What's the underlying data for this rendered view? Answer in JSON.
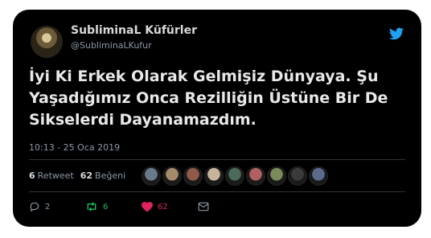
{
  "author": {
    "display_name": "SubliminaL Küfürler",
    "handle": "@SubliminaLKufur"
  },
  "tweet": {
    "line1": "İyi Ki Erkek Olarak Gelmişiz Dünyaya. Şu",
    "line2": "Yaşadığımız Onca Rezilliğin Üstüne Bir De",
    "line3": "Sikselerdi Dayanamazdım.",
    "timestamp": "10:13 - 25 Oca 2019"
  },
  "stats": {
    "retweet_count": "6",
    "retweet_label": "Retweet",
    "like_count": "62",
    "like_label": "Beğeni"
  },
  "likers": [
    "#6b7a8a",
    "#a58a6a",
    "#8f5a4a",
    "#c9b49a",
    "#4a6a5a",
    "#b06060",
    "#7a8a5a",
    "#3a3a3a",
    "#5a6a8a"
  ],
  "actions": {
    "reply_count": "2",
    "retweet_count": "6",
    "like_count": "62"
  },
  "colors": {
    "accent": "#1da1f2",
    "retweet": "#17bf63",
    "like": "#e0245e"
  }
}
